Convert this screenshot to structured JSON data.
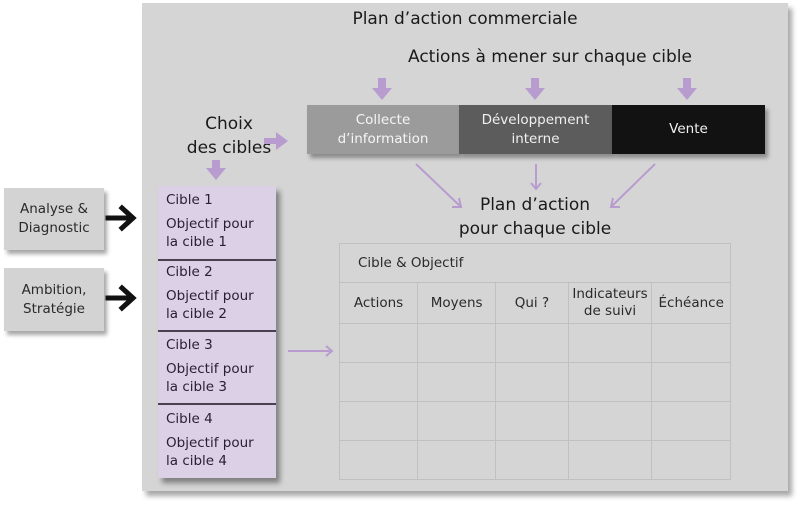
{
  "title": "Plan d’action commerciale",
  "actions_heading": "Actions à mener sur chaque cible",
  "actions": [
    {
      "line1": "Collecte",
      "line2": "d’information",
      "color": "#9b9b9b"
    },
    {
      "line1": "Développement",
      "line2": "interne",
      "color": "#5c5c5c"
    },
    {
      "line1": "Vente",
      "line2": "",
      "color": "#121212"
    }
  ],
  "choix": {
    "line1": "Choix",
    "line2": "des cibles"
  },
  "inputs": [
    {
      "line1": "Analyse &",
      "line2": "Diagnostic"
    },
    {
      "line1": "Ambition,",
      "line2": "Stratégie"
    }
  ],
  "cibles": [
    {
      "name": "Cible 1",
      "objective_line1": "Objectif pour",
      "objective_line2": "la cible 1"
    },
    {
      "name": "Cible 2",
      "objective_line1": "Objectif pour",
      "objective_line2": "la cible 2"
    },
    {
      "name": "Cible 3",
      "objective_line1": "Objectif pour",
      "objective_line2": "la cible 3"
    },
    {
      "name": "Cible 4",
      "objective_line1": "Objectif pour",
      "objective_line2": "la cible 4"
    }
  ],
  "plan_target": {
    "line1": "Plan d’action",
    "line2": "pour chaque cible"
  },
  "table": {
    "header": "Cible & Objectif",
    "columns": [
      {
        "line1": "Actions",
        "line2": ""
      },
      {
        "line1": "Moyens",
        "line2": ""
      },
      {
        "line1": "Qui ?",
        "line2": ""
      },
      {
        "line1": "Indicateurs",
        "line2": "de suivi"
      },
      {
        "line1": "Échéance",
        "line2": ""
      }
    ],
    "empty_rows": 4
  },
  "colors": {
    "panel": "#d5d5d5",
    "cible_fill": "#dcd0e6",
    "accent_arrow": "#b89ccf",
    "dark_arrow": "#111111"
  }
}
